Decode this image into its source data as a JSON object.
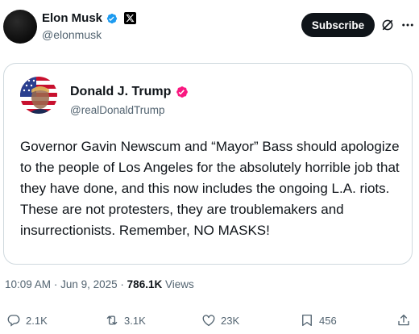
{
  "author": {
    "name": "Elon Musk",
    "handle": "@elonmusk"
  },
  "header": {
    "subscribe_label": "Subscribe"
  },
  "quoted_post": {
    "name": "Donald J. Trump",
    "handle": "@realDonaldTrump",
    "text": "Governor Gavin Newscum and “Mayor” Bass should apologize to the people of Los Angeles for the absolutely horrible job that they have done, and this now includes the ongoing L.A. riots. These are not protesters, they are troublemakers and insurrectionists. Remember, NO MASKS!"
  },
  "meta": {
    "time": "10:09 AM",
    "date": "Jun 9, 2025",
    "views_count": "786.1K",
    "views_label": "Views",
    "separator": "·"
  },
  "actions": {
    "replies": "2.1K",
    "reposts": "3.1K",
    "likes": "23K",
    "bookmarks": "456"
  },
  "icons": {
    "verified": "verified-badge-icon",
    "x_badge": "x-logo-icon",
    "grok": "grok-icon",
    "more": "more-icon",
    "reply": "reply-icon",
    "repost": "repost-icon",
    "like": "like-icon",
    "bookmark": "bookmark-icon",
    "share": "share-icon"
  },
  "colors": {
    "verified_blue": "#1d9bf0",
    "verified_pink": "#f91880",
    "text_primary": "#0f1419",
    "text_secondary": "#536471",
    "border": "#cfd9de"
  }
}
